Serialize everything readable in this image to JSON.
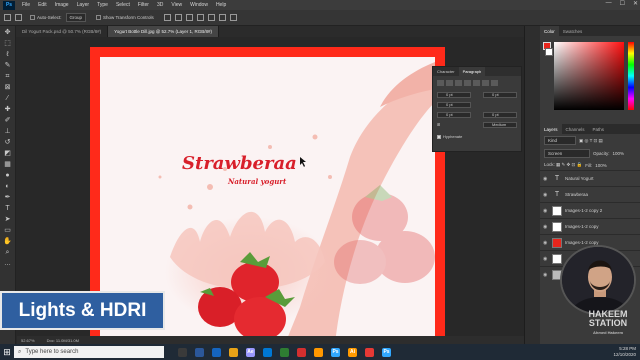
{
  "app": {
    "logo": "Ps",
    "menu": [
      "File",
      "Edit",
      "Image",
      "Layer",
      "Type",
      "Select",
      "Filter",
      "3D",
      "View",
      "Window",
      "Help"
    ],
    "window_controls": [
      "—",
      "☐",
      "✕"
    ]
  },
  "options_bar": {
    "auto_select": "Auto-Select:",
    "group": "Group",
    "show_transform": "Show Transform Controls"
  },
  "tabs": [
    {
      "label": "Dil Yogurt Pack.psd @ 50.7% (RGB/8#)",
      "active": false
    },
    {
      "label": "Yogurt Bottle Dill.jpg @ 52.7% (Layer 1, RGB/8#)",
      "active": true
    }
  ],
  "canvas": {
    "brand": "Strawberaa",
    "tagline": "Natural yogurt"
  },
  "character_panel": {
    "tabs": [
      "Character",
      "Paragraph"
    ],
    "active_tab": "Paragraph",
    "fields": [
      "0 pt",
      "0 pt",
      "0 pt",
      "0 pt",
      "0 pt"
    ],
    "medium_label": "Medium",
    "hyphenate": "Hyphenate"
  },
  "color_panel": {
    "tabs": [
      "Color",
      "Swatches"
    ],
    "active_tab": "Color"
  },
  "layers_panel": {
    "tabs": [
      "Layers",
      "Channels",
      "Paths"
    ],
    "active_tab": "Layers",
    "kind": "Kind",
    "blend_mode": "Screen",
    "opacity_label": "Opacity:",
    "opacity": "100%",
    "fill_label": "Fill:",
    "fill": "100%",
    "layers": [
      {
        "name": "Natural Yogurt",
        "thumb": "T"
      },
      {
        "name": "Strawberaa",
        "thumb": "T"
      },
      {
        "name": "Images-1-2 copy 2",
        "thumb": ""
      },
      {
        "name": "Images-1-2 copy",
        "thumb": ""
      },
      {
        "name": "Images-1-2 copy",
        "thumb": ""
      },
      {
        "name": "",
        "thumb": ""
      },
      {
        "name": "",
        "thumb": ""
      },
      {
        "name": "",
        "thumb": ""
      }
    ]
  },
  "overlay": {
    "title": "Lights & HDRI"
  },
  "watermark": {
    "name": "HAKEEM",
    "sub": "STATION",
    "tag": "Ahmed Hakeem"
  },
  "status_bar": {
    "zoom": "52.67%",
    "doc": "Doc: 11.0M/31.0M"
  },
  "taskbar": {
    "search_placeholder": "Type here to search",
    "time": "5:28 PM",
    "date": "12/10/2020",
    "apps": [
      {
        "label": "",
        "color": "#3a3a3a"
      },
      {
        "label": "",
        "color": "#2b579a"
      },
      {
        "label": "",
        "color": "#1565c0"
      },
      {
        "label": "",
        "color": "#e8a317"
      },
      {
        "label": "Ae",
        "color": "#9999ff"
      },
      {
        "label": "",
        "color": "#0078d4"
      },
      {
        "label": "",
        "color": "#2e7d32"
      },
      {
        "label": "",
        "color": "#d32f2f"
      },
      {
        "label": "",
        "color": "#ff9800"
      },
      {
        "label": "Ps",
        "color": "#31a8ff"
      },
      {
        "label": "Ai",
        "color": "#ff9a00"
      },
      {
        "label": "",
        "color": "#e53935"
      },
      {
        "label": "Ps",
        "color": "#31a8ff"
      }
    ]
  }
}
